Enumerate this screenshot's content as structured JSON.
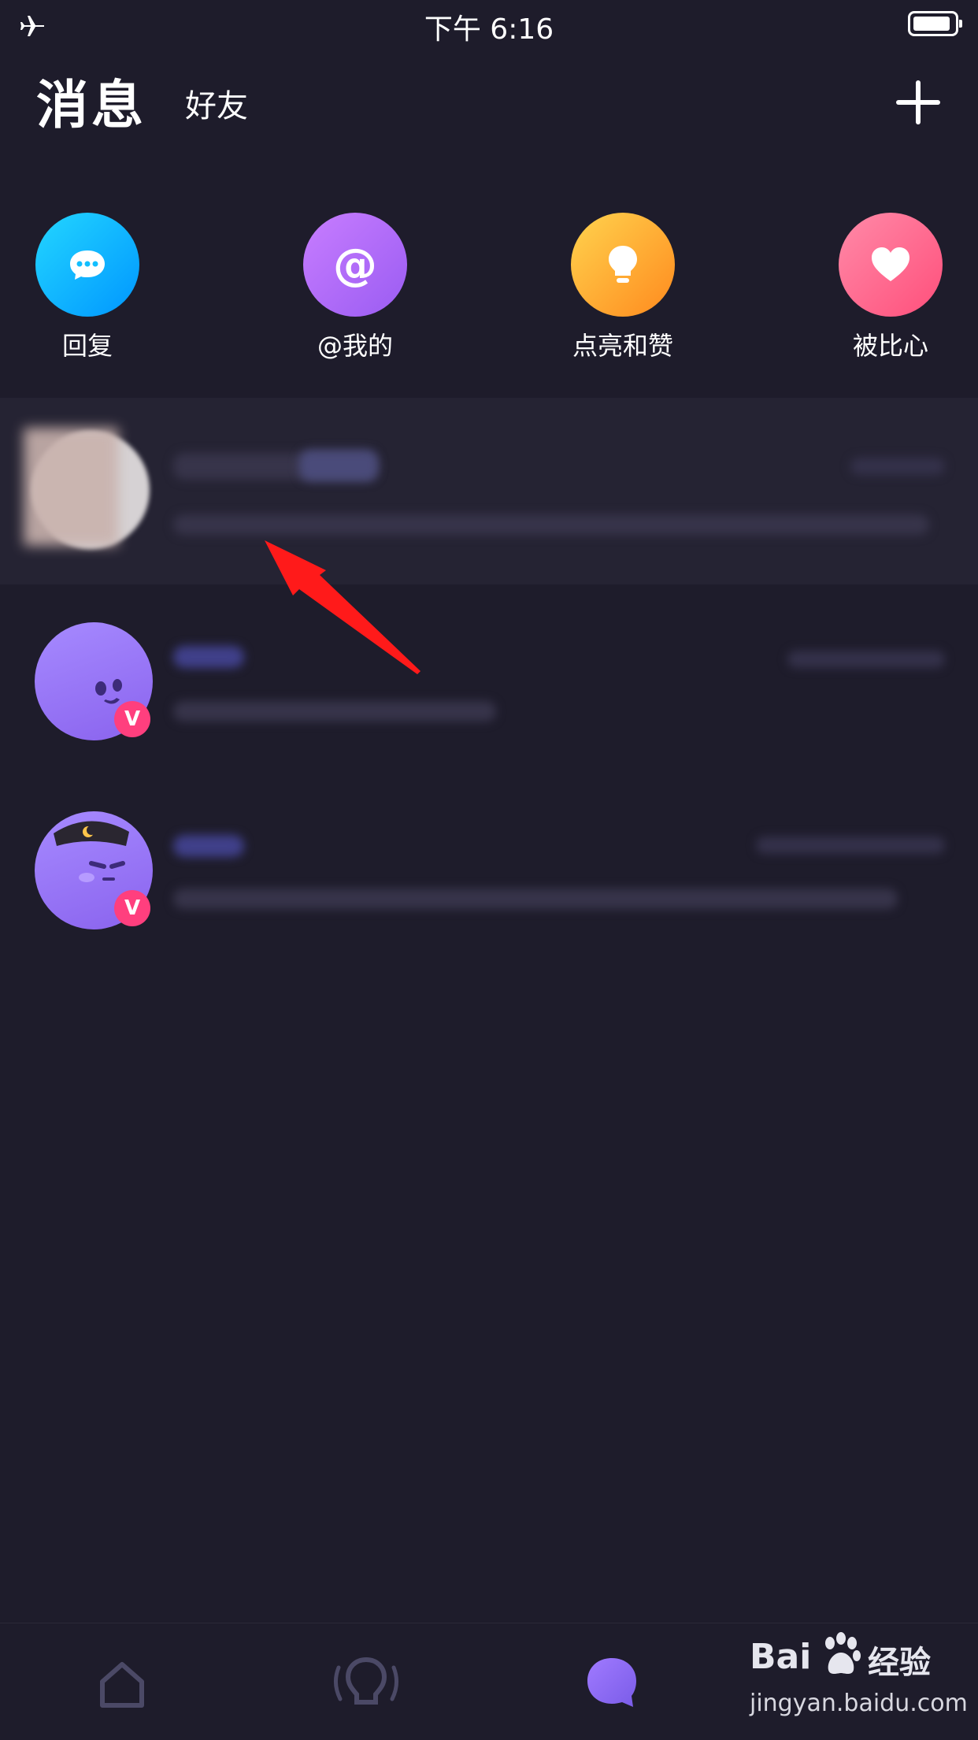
{
  "status_bar": {
    "time": "下午 6:16",
    "airplane_icon": "airplane-icon",
    "battery_icon": "battery-icon"
  },
  "header": {
    "tab_messages": "消息",
    "tab_friends": "好友",
    "add_icon": "plus-icon"
  },
  "quick_actions": [
    {
      "label": "回复",
      "icon": "chat-bubble-icon",
      "color": "#12bfff"
    },
    {
      "label": "@我的",
      "icon": "at-icon",
      "color": "#b270fa"
    },
    {
      "label": "点亮和赞",
      "icon": "lightbulb-icon",
      "color": "#ffb134"
    },
    {
      "label": "被比心",
      "icon": "heart-icon",
      "color": "#ff6690"
    }
  ],
  "tab_bar": [
    {
      "name": "home",
      "icon": "home-icon"
    },
    {
      "name": "discover",
      "icon": "bulb-outline-icon"
    },
    {
      "name": "messages",
      "icon": "message-bubble-icon",
      "active": true
    },
    {
      "name": "profile",
      "icon": "profile-icon"
    }
  ],
  "watermark": {
    "brand": "Bai",
    "brand2": "经验",
    "url": "jingyan.baidu.com"
  },
  "colors": {
    "background": "#1e1c2b",
    "accent": "#8b6cf0",
    "badge": "#ff3f7e",
    "arrow": "#ff1a1a"
  }
}
